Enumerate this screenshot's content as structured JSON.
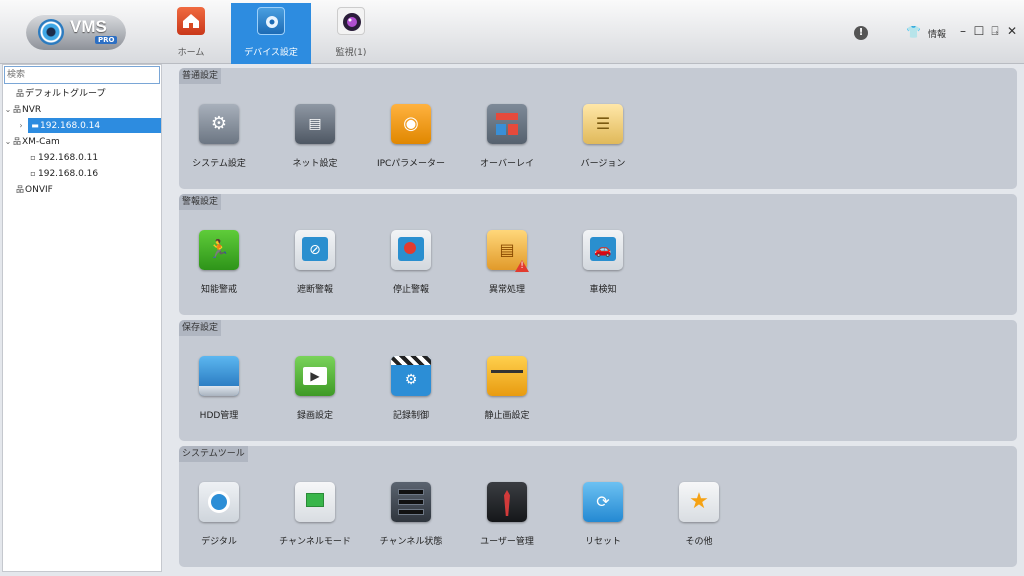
{
  "app": {
    "logo_text": "VMS",
    "logo_badge": "PRO"
  },
  "tabs": [
    {
      "label": "ホーム",
      "icon": "home-icon"
    },
    {
      "label": "デバイス設定",
      "icon": "device-settings-icon"
    },
    {
      "label": "監視(1)",
      "icon": "camera-monitor-icon"
    }
  ],
  "header": {
    "info_label": "情報",
    "alert_icon": "!",
    "shirt_icon": "👕"
  },
  "window_controls": {
    "minimize": "–",
    "maximize": "☐",
    "exit": "⍈",
    "close": "✕"
  },
  "sidebar": {
    "search_placeholder": "検索",
    "tree": [
      {
        "label": "デフォルトグループ",
        "icon": "network-icon"
      },
      {
        "label": "NVR",
        "icon": "network-icon",
        "caret": "⌄"
      },
      {
        "label": "192.168.0.14",
        "icon": "device-icon",
        "caret": "›",
        "selected": true
      },
      {
        "label": "XM-Cam",
        "icon": "network-icon",
        "caret": "⌄"
      },
      {
        "label": "192.168.0.11",
        "icon": "camera-icon"
      },
      {
        "label": "192.168.0.16",
        "icon": "camera-icon"
      },
      {
        "label": "ONVIF",
        "icon": "network-icon"
      }
    ]
  },
  "sections": [
    {
      "title": "普通設定",
      "items": [
        {
          "label": "システム設定",
          "icon": "gear-icon"
        },
        {
          "label": "ネット設定",
          "icon": "network-port-icon"
        },
        {
          "label": "IPCパラメーター",
          "icon": "ipc-camera-icon"
        },
        {
          "label": "オーバーレイ",
          "icon": "overlay-icon"
        },
        {
          "label": "バージョン",
          "icon": "version-icon"
        }
      ]
    },
    {
      "title": "警報設定",
      "items": [
        {
          "label": "知能警戒",
          "icon": "intelligent-alert-icon"
        },
        {
          "label": "遮断警報",
          "icon": "mask-alarm-icon"
        },
        {
          "label": "停止警報",
          "icon": "stop-alarm-icon"
        },
        {
          "label": "異常処理",
          "icon": "abnormal-handling-icon"
        },
        {
          "label": "車検知",
          "icon": "car-detect-icon"
        }
      ]
    },
    {
      "title": "保存設定",
      "items": [
        {
          "label": "HDD管理",
          "icon": "hdd-icon"
        },
        {
          "label": "録画設定",
          "icon": "record-settings-icon"
        },
        {
          "label": "記録制御",
          "icon": "record-control-icon"
        },
        {
          "label": "静止画設定",
          "icon": "still-image-icon"
        }
      ]
    },
    {
      "title": "システムツール",
      "items": [
        {
          "label": "デジタル",
          "icon": "digital-icon"
        },
        {
          "label": "チャンネルモード",
          "icon": "channel-mode-icon"
        },
        {
          "label": "チャンネル状態",
          "icon": "channel-status-icon"
        },
        {
          "label": "ユーザー管理",
          "icon": "user-management-icon"
        },
        {
          "label": "リセット",
          "icon": "reset-icon"
        },
        {
          "label": "その他",
          "icon": "other-icon"
        }
      ]
    }
  ]
}
